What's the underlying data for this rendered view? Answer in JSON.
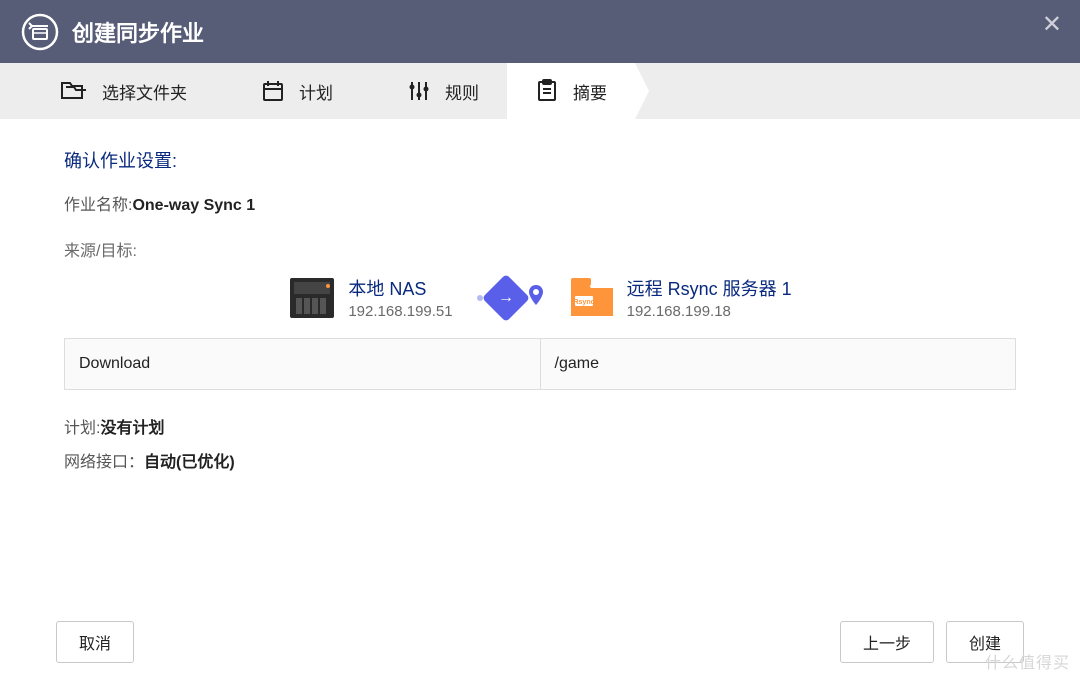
{
  "titlebar": {
    "title": "创建同步作业"
  },
  "steps": {
    "folder": "选择文件夹",
    "schedule": "计划",
    "rules": "规则",
    "summary": "摘要"
  },
  "content": {
    "section_title": "确认作业设置:",
    "job_name_label": "作业名称:",
    "job_name_value": "One-way Sync 1",
    "src_tgt_label": "来源/目标:",
    "source": {
      "name": "本地 NAS",
      "ip": "192.168.199.51"
    },
    "target": {
      "name": "远程 Rsync 服务器 1",
      "ip": "192.168.199.18"
    },
    "path_source": "Download",
    "path_target": "/game",
    "schedule_label": "计划:",
    "schedule_value": "没有计划",
    "iface_label": "网络接口：",
    "iface_value": "自动(已优化)"
  },
  "footer": {
    "cancel": "取消",
    "prev": "上一步",
    "create": "创建"
  },
  "watermark": "什么值得买"
}
